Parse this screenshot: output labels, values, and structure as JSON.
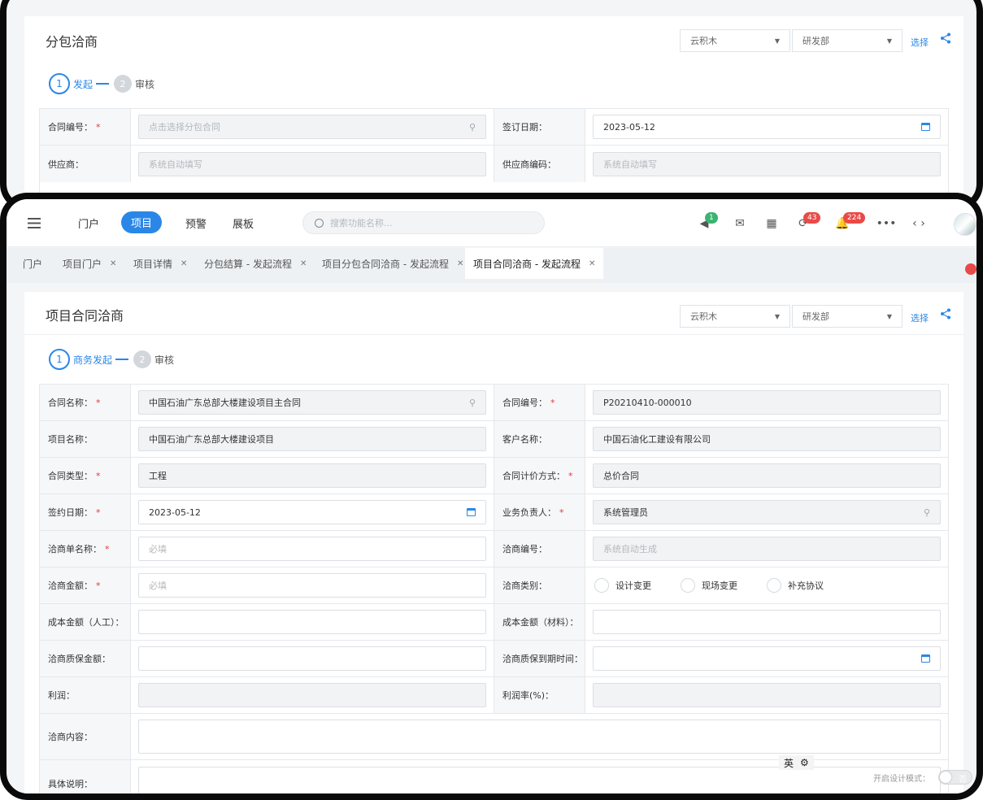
{
  "back": {
    "title": "分包洽商",
    "company": "云积木",
    "department": "研发部",
    "select_link": "选择",
    "steps": [
      {
        "num": "1",
        "label": "发起"
      },
      {
        "num": "2",
        "label": "审核"
      }
    ],
    "rows": [
      {
        "label": "合同编号：",
        "value": "点击选择分包合同",
        "label2": "签订日期：",
        "value2": "2023-05-12"
      },
      {
        "label": "供应商：",
        "value": "系统自动填写",
        "label2": "供应商编码：",
        "value2": "系统自动填写"
      }
    ]
  },
  "topbar": {
    "nav": [
      "门户",
      "项目",
      "预警",
      "展板"
    ],
    "search_placeholder": "搜索功能名称...",
    "badges": {
      "announce": "1",
      "sync": "43",
      "bell": "224"
    }
  },
  "tabs": [
    "门户",
    "项目门户",
    "项目详情",
    "分包结算 - 发起流程",
    "项目分包合同洽商 - 发起流程",
    "项目合同洽商 - 发起流程"
  ],
  "main": {
    "title": "项目合同洽商",
    "company": "云积木",
    "department": "研发部",
    "select_link": "选择",
    "steps": [
      {
        "num": "1",
        "label": "商务发起"
      },
      {
        "num": "2",
        "label": "审核"
      }
    ],
    "fields": {
      "contract_name_label": "合同名称：",
      "contract_name": "中国石油广东总部大楼建设项目主合同",
      "contract_no_label": "合同编号：",
      "contract_no": "P20210410-000010",
      "project_name_label": "项目名称：",
      "project_name": "中国石油广东总部大楼建设项目",
      "customer_label": "客户名称：",
      "customer": "中国石油化工建设有限公司",
      "contract_type_label": "合同类型：",
      "contract_type": "工程",
      "pricing_label": "合同计价方式：",
      "pricing": "总价合同",
      "sign_date_label": "签约日期：",
      "sign_date": "2023-05-12",
      "owner_label": "业务负责人：",
      "owner": "系统管理员",
      "neg_name_label": "洽商单名称：",
      "neg_name_ph": "必填",
      "neg_no_label": "洽商编号：",
      "neg_no": "系统自动生成",
      "neg_amount_label": "洽商金额：",
      "neg_amount_ph": "必填",
      "neg_type_label": "洽商类别：",
      "neg_types": [
        "设计变更",
        "现场变更",
        "补充协议"
      ],
      "cost_labor_label": "成本金额（人工）：",
      "cost_material_label": "成本金额（材料）：",
      "deposit_label": "洽商质保金额：",
      "deposit_due_label": "洽商质保到期时间：",
      "profit_label": "利润：",
      "profit_rate_label": "利润率(%)：",
      "content_label": "洽商内容：",
      "detail_label": "具体说明："
    }
  },
  "ime": {
    "label": "英"
  },
  "design_mode": {
    "label": "开启设计模式：",
    "toggle": "否"
  }
}
